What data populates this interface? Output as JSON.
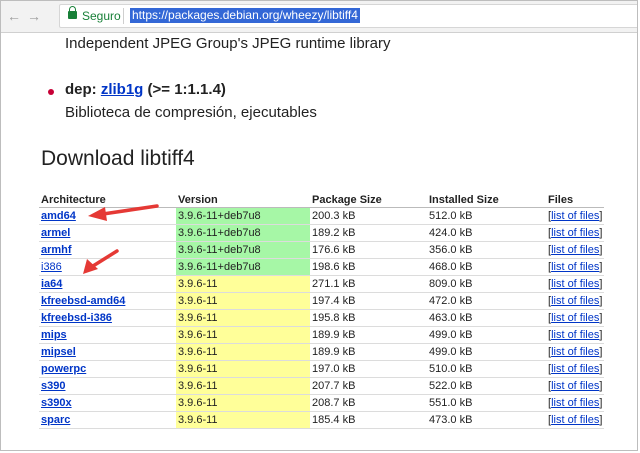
{
  "browser": {
    "secure_label": "Seguro",
    "url": "https://packages.debian.org/wheezy/libtiff4"
  },
  "page": {
    "prev_description": "Independent JPEG Group's JPEG runtime library",
    "dependency": {
      "prefix": "dep:",
      "package": "zlib1g",
      "version": "(>= 1:1.1.4)",
      "description": "Biblioteca de compresión, ejecutables"
    },
    "download_title": "Download libtiff4",
    "table": {
      "headers": [
        "Architecture",
        "Version",
        "Package Size",
        "Installed Size",
        "Files"
      ],
      "rows": [
        {
          "arch": "amd64",
          "version": "3.9.6-11+deb7u8",
          "pkg": "200.3 kB",
          "inst": "512.0 kB",
          "files": "list of files"
        },
        {
          "arch": "armel",
          "version": "3.9.6-11+deb7u8",
          "pkg": "189.2 kB",
          "inst": "424.0 kB",
          "files": "list of files"
        },
        {
          "arch": "armhf",
          "version": "3.9.6-11+deb7u8",
          "pkg": "176.6 kB",
          "inst": "356.0 kB",
          "files": "list of files"
        },
        {
          "arch": "i386",
          "version": "3.9.6-11+deb7u8",
          "pkg": "198.6 kB",
          "inst": "468.0 kB",
          "files": "list of files"
        },
        {
          "arch": "ia64",
          "version": "3.9.6-11",
          "pkg": "271.1 kB",
          "inst": "809.0 kB",
          "files": "list of files"
        },
        {
          "arch": "kfreebsd-amd64",
          "version": "3.9.6-11",
          "pkg": "197.4 kB",
          "inst": "472.0 kB",
          "files": "list of files"
        },
        {
          "arch": "kfreebsd-i386",
          "version": "3.9.6-11",
          "pkg": "195.8 kB",
          "inst": "463.0 kB",
          "files": "list of files"
        },
        {
          "arch": "mips",
          "version": "3.9.6-11",
          "pkg": "189.9 kB",
          "inst": "499.0 kB",
          "files": "list of files"
        },
        {
          "arch": "mipsel",
          "version": "3.9.6-11",
          "pkg": "189.9 kB",
          "inst": "499.0 kB",
          "files": "list of files"
        },
        {
          "arch": "powerpc",
          "version": "3.9.6-11",
          "pkg": "197.0 kB",
          "inst": "510.0 kB",
          "files": "list of files"
        },
        {
          "arch": "s390",
          "version": "3.9.6-11",
          "pkg": "207.7 kB",
          "inst": "522.0 kB",
          "files": "list of files"
        },
        {
          "arch": "s390x",
          "version": "3.9.6-11",
          "pkg": "208.7 kB",
          "inst": "551.0 kB",
          "files": "list of files"
        },
        {
          "arch": "sparc",
          "version": "3.9.6-11",
          "pkg": "185.4 kB",
          "inst": "473.0 kB",
          "files": "list of files"
        }
      ]
    }
  },
  "colors": {
    "link": "#0035c7",
    "version_security": "#a6f7a6",
    "version_base": "#ffff99",
    "annotation_arrow": "#e53935",
    "secure_green": "#188038"
  },
  "icons": [
    "back-arrow-icon",
    "forward-arrow-icon",
    "reload-icon",
    "lock-icon",
    "annotation-arrow-icon",
    "bullet-icon"
  ]
}
